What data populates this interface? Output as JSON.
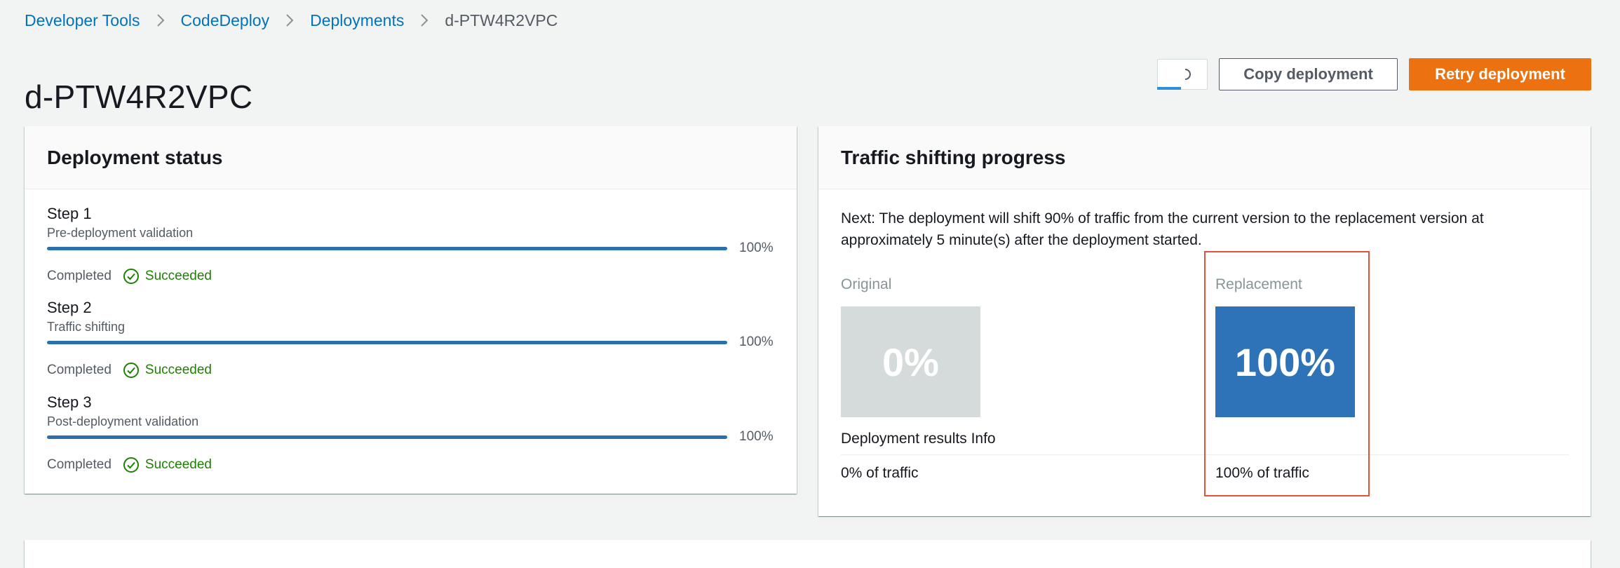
{
  "breadcrumb": {
    "items": [
      "Developer Tools",
      "CodeDeploy",
      "Deployments"
    ],
    "current": "d-PTW4R2VPC"
  },
  "page": {
    "title": "d-PTW4R2VPC"
  },
  "header_buttons": {
    "copy_label": "Copy deployment",
    "retry_label": "Retry deployment"
  },
  "deployment_status": {
    "title": "Deployment status",
    "steps": [
      {
        "title": "Step 1",
        "subtitle": "Pre-deployment validation",
        "progress": "100%",
        "state": "Completed",
        "result": "Succeeded"
      },
      {
        "title": "Step 2",
        "subtitle": "Traffic shifting",
        "progress": "100%",
        "state": "Completed",
        "result": "Succeeded"
      },
      {
        "title": "Step 3",
        "subtitle": "Post-deployment validation",
        "progress": "100%",
        "state": "Completed",
        "result": "Succeeded"
      }
    ]
  },
  "traffic": {
    "title": "Traffic shifting progress",
    "next_text": "Next: The deployment will shift 90% of traffic from the current version to the replacement version at approximately 5 minute(s) after the deployment started.",
    "original": {
      "label": "Original",
      "percent": "0%",
      "traffic": "0% of traffic"
    },
    "replacement": {
      "label": "Replacement",
      "percent": "100%",
      "traffic": "100% of traffic"
    },
    "results_label": "Deployment results Info"
  },
  "colors": {
    "link": "#0073bb",
    "primary_button": "#ec7211",
    "progress_bar": "#2c6fad",
    "success": "#1d8102",
    "replacement_box": "#2e73b8",
    "original_box": "#d5dbdb",
    "highlight": "#e0523b"
  },
  "icons": [
    "chevron-right-icon",
    "spinner-icon",
    "check-circle-icon"
  ]
}
